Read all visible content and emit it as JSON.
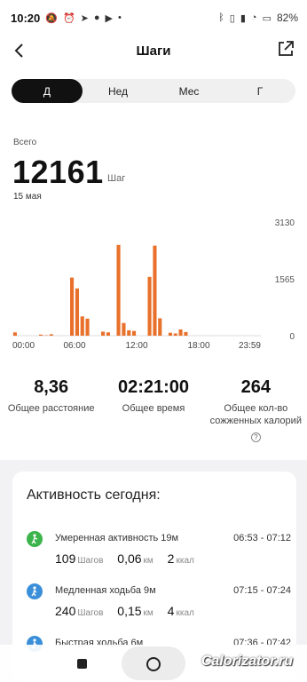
{
  "status_bar": {
    "time": "10:20",
    "battery": "82%"
  },
  "header": {
    "title": "Шаги"
  },
  "tabs": [
    "Д",
    "Нед",
    "Мес",
    "Г"
  ],
  "summary": {
    "label": "Всего",
    "value": "12161",
    "unit": "Шаг",
    "date": "15 мая"
  },
  "chart_data": {
    "type": "bar",
    "x_tick_labels": [
      "00:00",
      "06:00",
      "12:00",
      "18:00",
      "23:59"
    ],
    "y_tick_labels": [
      "3130",
      "1565",
      "0"
    ],
    "ylim": [
      0,
      3130
    ],
    "color": "#e8702a",
    "slots": 48,
    "values": [
      90,
      0,
      0,
      0,
      0,
      30,
      10,
      40,
      0,
      0,
      0,
      1600,
      1300,
      530,
      470,
      0,
      0,
      110,
      90,
      0,
      2500,
      350,
      150,
      130,
      0,
      0,
      1620,
      2480,
      480,
      0,
      80,
      60,
      170,
      100,
      0,
      0,
      0,
      0,
      0,
      0,
      0,
      0,
      0,
      0,
      0,
      0,
      0,
      0
    ]
  },
  "stats": [
    {
      "value": "8,36",
      "label": "Общее расстояние"
    },
    {
      "value": "02:21:00",
      "label": "Общее время"
    },
    {
      "value": "264",
      "label": "Общее кол-во сожженных калорий"
    }
  ],
  "activity": {
    "title": "Активность сегодня:",
    "items": [
      {
        "name": "Умеренная активность 19м",
        "range": "06:53 - 07:12",
        "steps": "109",
        "steps_unit": "Шагов",
        "km": "0,06",
        "km_unit": "км",
        "kcal": "2",
        "kcal_unit": "ккал",
        "color": "#3cb44b",
        "icon": "hiking-icon"
      },
      {
        "name": "Медленная ходьба 9м",
        "range": "07:15 - 07:24",
        "steps": "240",
        "steps_unit": "Шагов",
        "km": "0,15",
        "km_unit": "км",
        "kcal": "4",
        "kcal_unit": "ккал",
        "color": "#3b8fd9",
        "icon": "walking-icon"
      },
      {
        "name": "Быстрая ходьба 6м",
        "range": "07:36 - 07:42",
        "color": "#3b8fd9",
        "icon": "walking-icon"
      }
    ]
  },
  "watermark": "Calorizator.ru"
}
